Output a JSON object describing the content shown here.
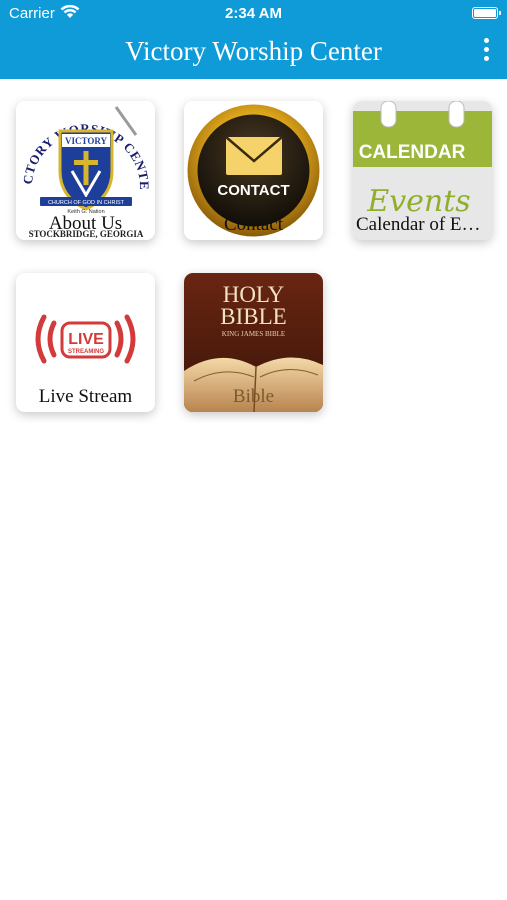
{
  "status_bar": {
    "carrier": "Carrier",
    "time": "2:34 AM"
  },
  "nav": {
    "title": "Victory Worship Center",
    "menu_icon": "more-vertical-icon"
  },
  "colors": {
    "accent": "#0f9bd7"
  },
  "tiles": [
    {
      "label": "About Us",
      "logo": {
        "arc_text": "VICTORY WORSHIP CENTER",
        "shield_text": "VICTORY",
        "ribbon": "CHURCH OF GOD IN CHRIST",
        "pastor": "Keith G. Nation",
        "location": "STOCKBRIDGE, GEORGIA"
      }
    },
    {
      "label": "Contact",
      "badge_text": "CONTACT"
    },
    {
      "label": "Calendar of Events",
      "header_text": "CALENDAR",
      "script_text": "Events"
    },
    {
      "label": "Live Stream",
      "logo_text": "LIVE",
      "logo_subtext": "STREAMING"
    },
    {
      "label": "Bible",
      "title_line1": "HOLY",
      "title_line2": "BIBLE",
      "subtitle": "KING JAMES BIBLE"
    }
  ]
}
